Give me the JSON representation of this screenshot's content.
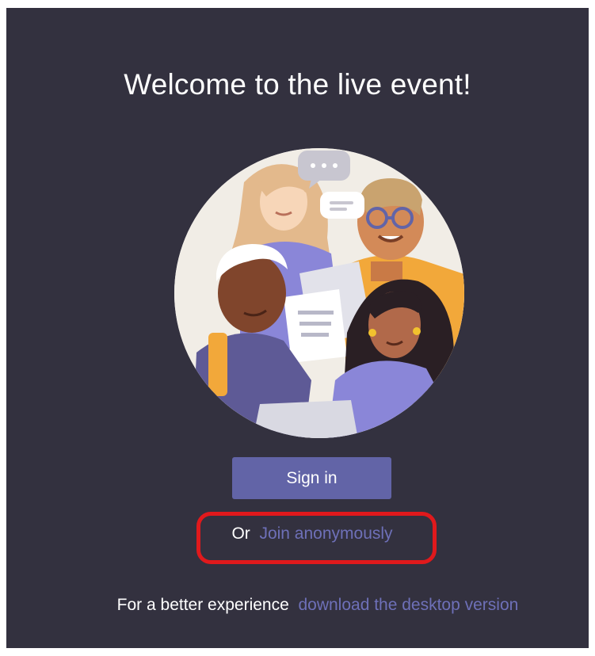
{
  "welcome": {
    "title": "Welcome to the live event!"
  },
  "illustration": {
    "icon": "people-group-illustration",
    "chat_bubble_text": "..."
  },
  "actions": {
    "signin_label": "Sign in",
    "or_prefix": "Or",
    "join_anonymously_label": "Join anonymously"
  },
  "footer": {
    "prefix": "For a better experience",
    "download_link_label": "download the desktop version"
  },
  "colors": {
    "background": "#33313f",
    "accent": "#6264a7",
    "link": "#6e70b8",
    "annotation_highlight": "#e0191c"
  }
}
